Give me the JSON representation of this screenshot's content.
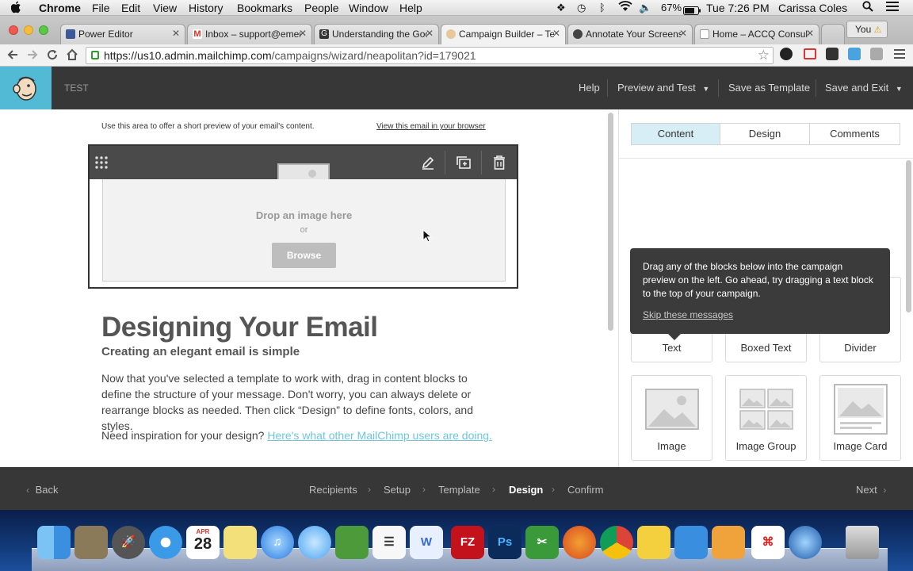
{
  "mac_menubar": {
    "apple": "",
    "items": [
      "Chrome",
      "File",
      "Edit",
      "View",
      "History",
      "Bookmarks",
      "People",
      "Window",
      "Help"
    ],
    "battery": "67%",
    "clock": "Tue 7:26 PM",
    "user": "Carissa Coles"
  },
  "browser": {
    "tabs": [
      {
        "label": "Power Editor",
        "color": "#3b5998"
      },
      {
        "label": "Inbox – support@emer",
        "color": "#d93025"
      },
      {
        "label": "Understanding the Goo",
        "color": "#333333"
      },
      {
        "label": "Campaign Builder – Te",
        "color": "#52bad5"
      },
      {
        "label": "Annotate Your Screensh",
        "color": "#444444"
      },
      {
        "label": "Home – ACCQ Consulta",
        "color": "#ffffff"
      }
    ],
    "profile_label": "You",
    "url_host": "https://us10.admin.mailchimp.com",
    "url_path": "/campaigns/wizard/neapolitan?id=179021"
  },
  "header": {
    "campaign_name": "TEST",
    "help": "Help",
    "preview_and_test": "Preview and Test",
    "save_as_template": "Save as Template",
    "save_and_exit": "Save and Exit"
  },
  "editor": {
    "preview_text": "Use this area to offer a short preview of your email's content.",
    "view_in_browser": "View this email in your browser",
    "drop_image": "Drop an image here",
    "or": "or",
    "browse": "Browse",
    "heading": "Designing Your Email",
    "subheading": "Creating an elegant email is simple",
    "paragraph": "Now that you've selected a template to work with, drag in content blocks to define the structure of your message. Don't worry, you can always delete or rearrange blocks as needed. Then click “Design” to define fonts, colors, and styles.",
    "inspiration_prefix": "Need inspiration for your design?",
    "inspiration_link": "Here's what other MailChimp users are doing."
  },
  "panel": {
    "tabs": [
      "Content",
      "Design",
      "Comments"
    ],
    "blocks_row1": [
      "Text",
      "Boxed Text",
      "Divider"
    ],
    "blocks_row2": [
      "Image",
      "Image Group",
      "Image Card"
    ]
  },
  "tooltip": {
    "message": "Drag any of the blocks below into the campaign preview on the left. Go ahead, try dragging a text block to the top of your campaign.",
    "skip": "Skip these messages"
  },
  "footer": {
    "back": "Back",
    "steps": [
      "Recipients",
      "Setup",
      "Template",
      "Design",
      "Confirm"
    ],
    "current_step": "Design",
    "next": "Next"
  },
  "dock": {
    "calendar_month": "APR",
    "calendar_day": "28",
    "apps": [
      "finder-icon",
      "mail-icon",
      "launchpad-icon",
      "safari-icon",
      "calendar-icon",
      "notes-icon",
      "itunes-icon",
      "messages-icon",
      "tweetdeck-icon",
      "reminders-icon",
      "textedit-icon",
      "word-icon",
      "filezilla-icon",
      "photoshop-icon",
      "scissors-icon",
      "firefox-icon",
      "chrome-icon",
      "wunderlist-icon",
      "notebook-icon",
      "stamp-icon",
      "acrobat-icon",
      "quicktime-icon",
      "trash-icon"
    ],
    "filezilla": "FZ",
    "photoshop": "Ps"
  }
}
